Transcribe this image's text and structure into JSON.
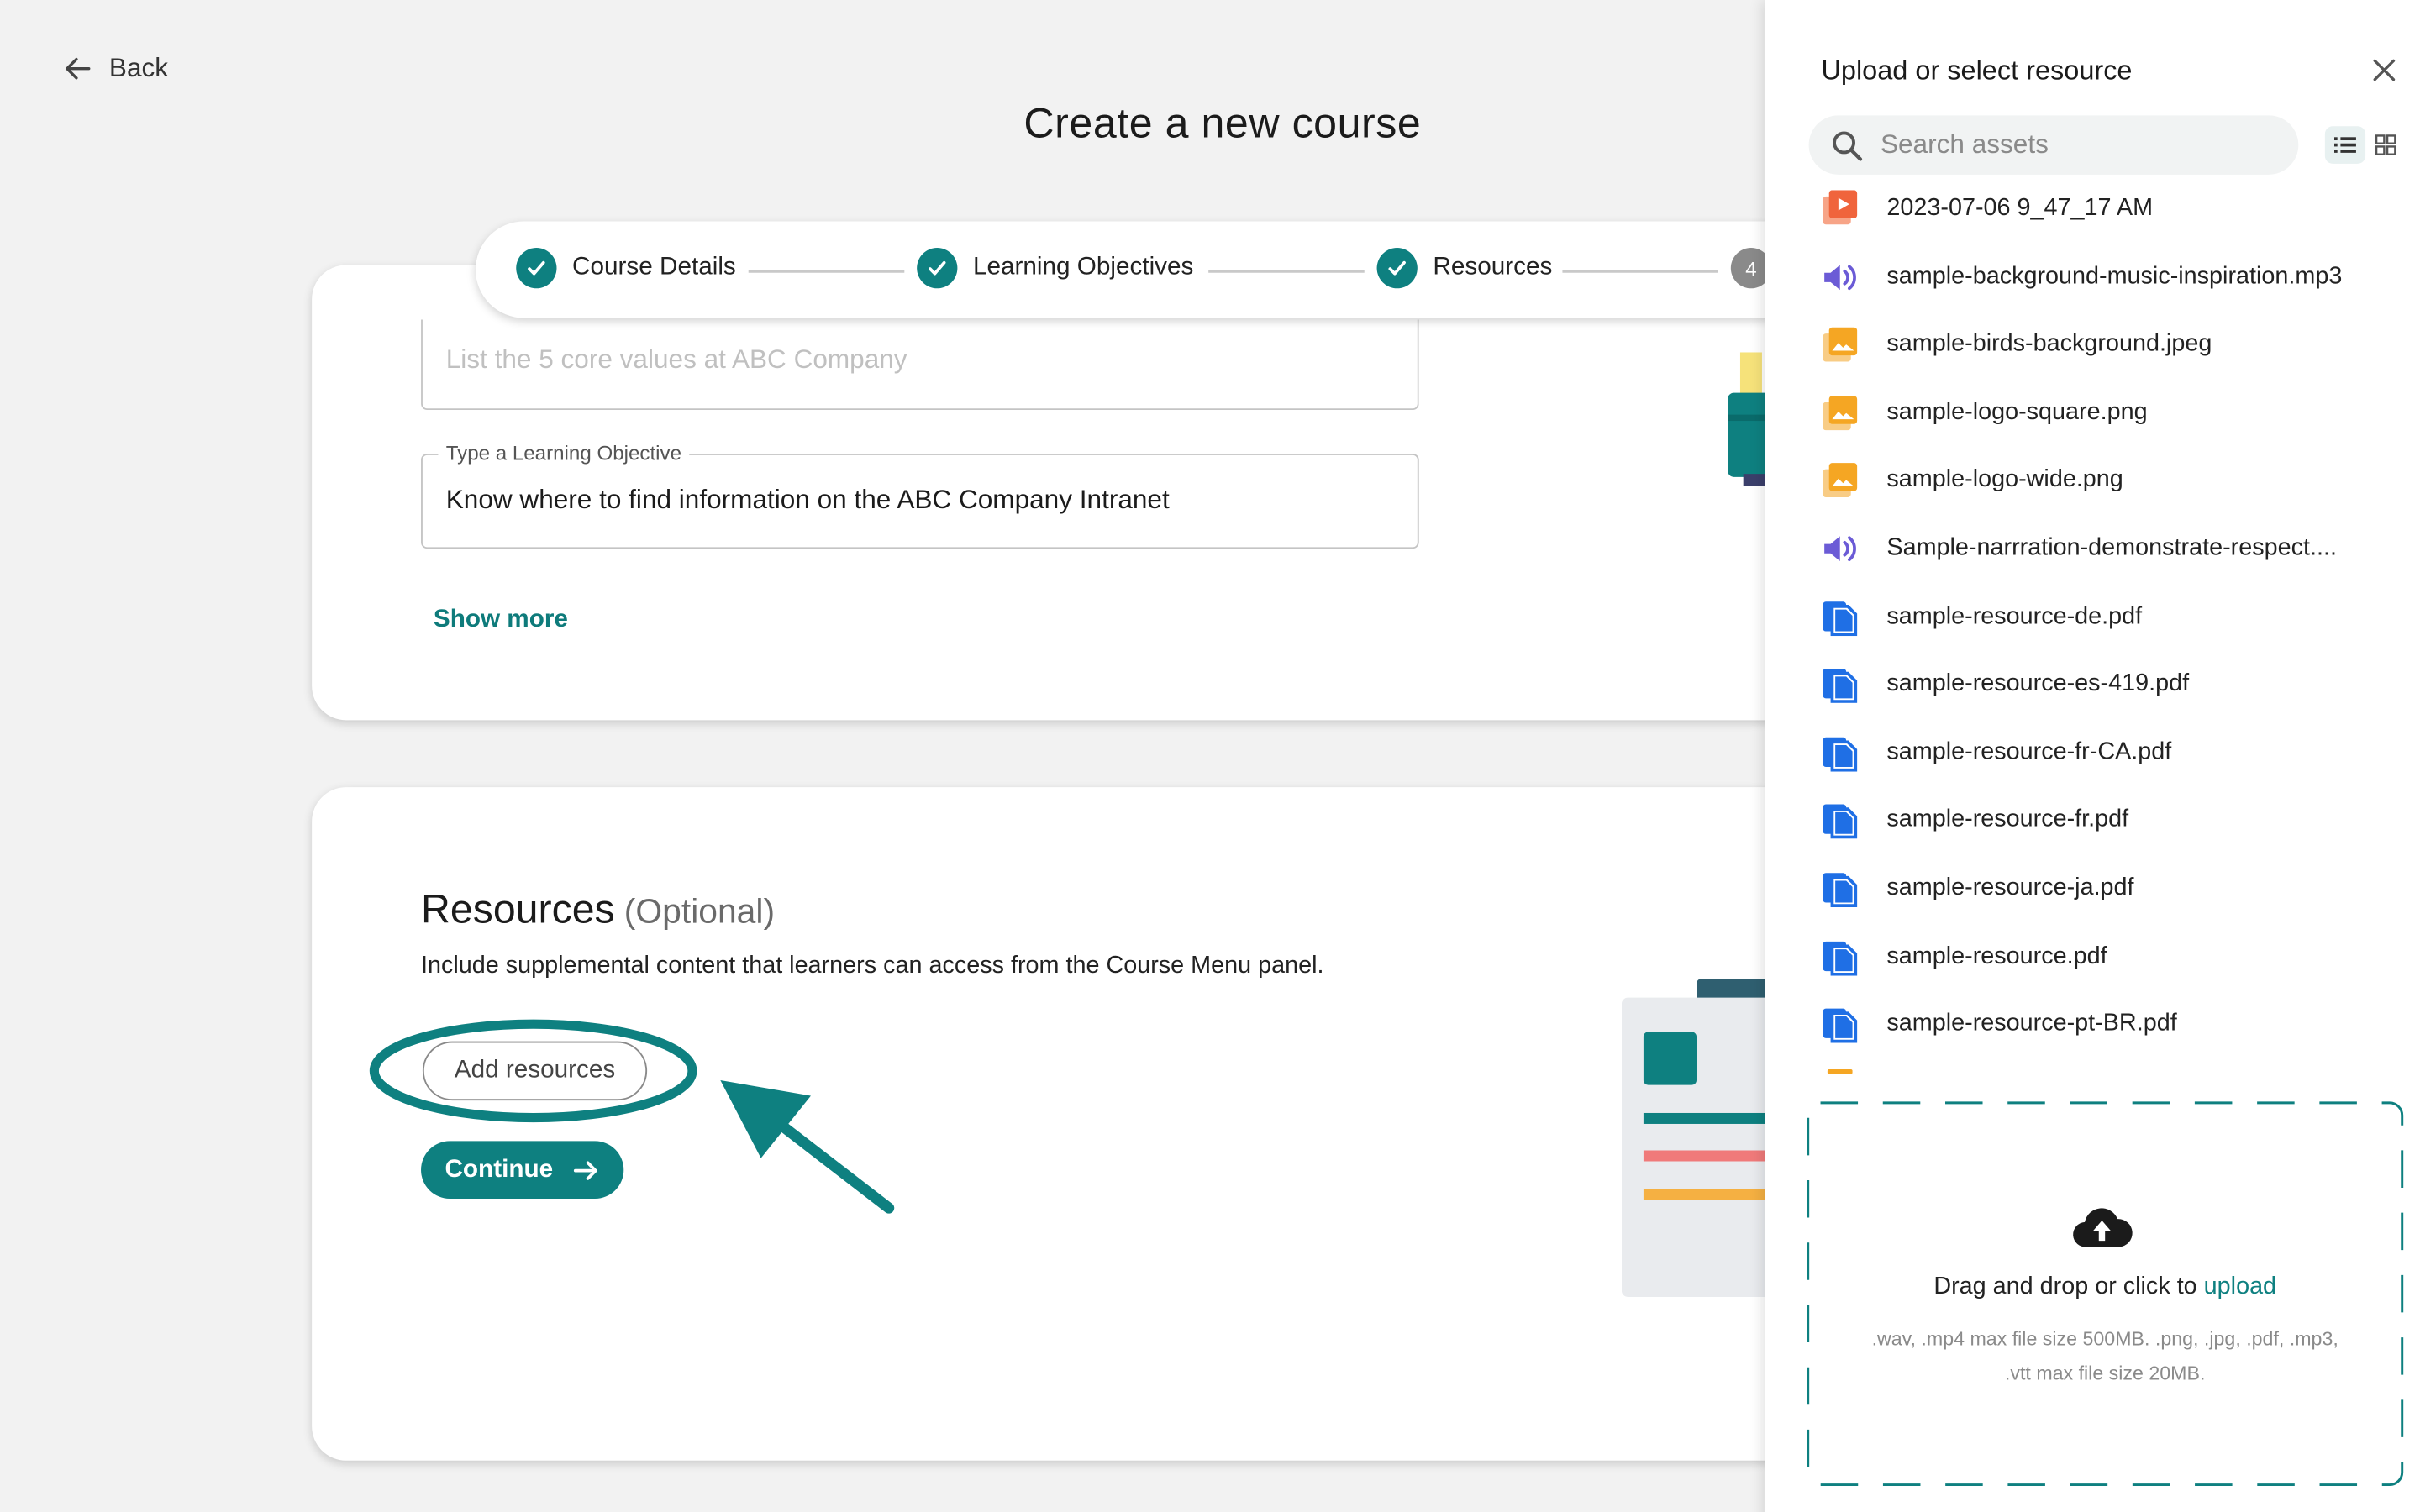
{
  "nav": {
    "back_label": "Back"
  },
  "page": {
    "title": "Create a new course"
  },
  "stepper": {
    "steps": [
      {
        "label": "Course Details",
        "state": "complete"
      },
      {
        "label": "Learning Objectives",
        "state": "complete"
      },
      {
        "label": "Resources",
        "state": "complete"
      },
      {
        "label": "4",
        "state": "upcoming"
      }
    ]
  },
  "objectives": {
    "faded_value": "List the 5 core values at ABC Company",
    "field_label": "Type a Learning Objective",
    "field_value": "Know where to find information on the ABC Company Intranet",
    "show_more": "Show more"
  },
  "resources": {
    "title": "Resources",
    "optional": "(Optional)",
    "description": "Include supplemental content that learners can access from the Course Menu panel.",
    "add_button": "Add resources",
    "continue_button": "Continue"
  },
  "panel": {
    "title": "Upload or select resource",
    "search_placeholder": "Search assets",
    "view_mode": "list",
    "files": [
      {
        "name": "2023-07-06 9_47_17 AM",
        "icon": "video-icon"
      },
      {
        "name": "sample-background-music-inspiration.mp3",
        "icon": "audio-icon"
      },
      {
        "name": "sample-birds-background.jpeg",
        "icon": "image-icon"
      },
      {
        "name": "sample-logo-square.png",
        "icon": "image-icon"
      },
      {
        "name": "sample-logo-wide.png",
        "icon": "image-icon"
      },
      {
        "name": "Sample-narrration-demonstrate-respect....",
        "icon": "audio-icon"
      },
      {
        "name": "sample-resource-de.pdf",
        "icon": "document-icon"
      },
      {
        "name": "sample-resource-es-419.pdf",
        "icon": "document-icon"
      },
      {
        "name": "sample-resource-fr-CA.pdf",
        "icon": "document-icon"
      },
      {
        "name": "sample-resource-fr.pdf",
        "icon": "document-icon"
      },
      {
        "name": "sample-resource-ja.pdf",
        "icon": "document-icon"
      },
      {
        "name": "sample-resource.pdf",
        "icon": "document-icon"
      },
      {
        "name": "sample-resource-pt-BR.pdf",
        "icon": "document-icon"
      }
    ],
    "dropzone": {
      "main_text": "Drag and drop or click to ",
      "link_text": "upload",
      "sub_text": ".wav, .mp4 max file size 500MB. .png, .jpg, .pdf, .mp3, .vtt max file size 20MB."
    }
  },
  "colors": {
    "accent": "#0e8080",
    "video": "#f0643c",
    "audio": "#6b5bd6",
    "image": "#f5a623",
    "document": "#1f6fe5"
  }
}
